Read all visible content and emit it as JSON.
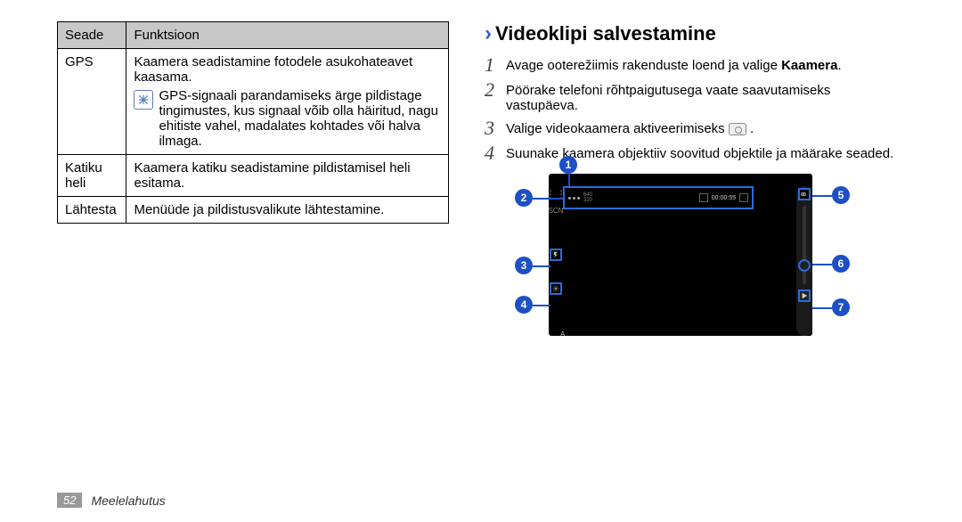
{
  "table": {
    "headers": {
      "col1": "Seade",
      "col2": "Funktsioon"
    },
    "rows": [
      {
        "label": "GPS",
        "text1": "Kaamera seadistamine fotodele asukohateavet kaasama.",
        "note": "GPS-signaali parandamiseks ärge pildistage tingimustes, kus signaal võib olla häiritud, nagu ehitiste vahel, madalates kohtades või halva ilmaga."
      },
      {
        "label": "Katiku heli",
        "text1": "Kaamera katiku seadistamine pildistamisel heli esitama."
      },
      {
        "label": "Lähtesta",
        "text1": "Menüüde ja pildistusvalikute lähtestamine."
      }
    ]
  },
  "heading": "Videoklipi salvestamine",
  "steps": {
    "s1a": "Avage ooterežiimis rakenduste loend ja valige ",
    "s1b": "Kaamera",
    "s1c": ".",
    "s2": "Pöörake telefoni rõhtpaigutusega vaate saavutamiseks vastupäeva.",
    "s3": "Valige videokaamera aktiveerimiseks ",
    "s4": "Suunake kaamera objektiiv soovitud objektile ja määrake seaded."
  },
  "viewer": {
    "timer": "00:00:55",
    "res": "640\n320"
  },
  "callouts": [
    "1",
    "2",
    "3",
    "4",
    "5",
    "6",
    "7"
  ],
  "footer": {
    "page": "52",
    "section": "Meelelahutus"
  }
}
